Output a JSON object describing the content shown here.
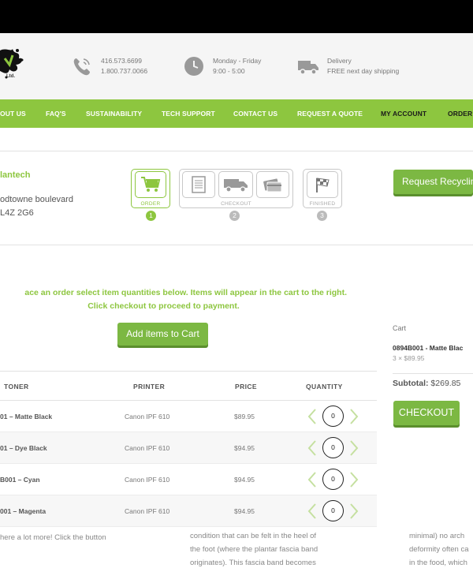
{
  "header": {
    "phone_1": "416.573.6699",
    "phone_2": "1.800.737.0066",
    "hours_1": "Monday - Friday",
    "hours_2": "9:00 - 5:00",
    "delivery_1": "Delivery",
    "delivery_2": "FREE next day shipping",
    "logo_text": "Ltd."
  },
  "nav": {
    "items": [
      "OUT US",
      "FAQ'S",
      "SUSTAINABILITY",
      "TECH SUPPORT",
      "CONTACT US",
      "REQUEST A QUOTE",
      "MY ACCOUNT",
      "ORDER"
    ]
  },
  "customer": {
    "company": "lantech",
    "street": "odtowne boulevard",
    "postal": "L4Z 2G6"
  },
  "progress": {
    "steps": [
      {
        "label": "ORDER",
        "number": "1"
      },
      {
        "label": "CHECKOUT",
        "number": "2"
      },
      {
        "label": "FINISHED",
        "number": "3"
      }
    ]
  },
  "actions": {
    "request_recycling": "Request Recyclin",
    "add_items": "Add items to Cart",
    "checkout": "CHECKOUT"
  },
  "instructions": {
    "line1": "ace an order select item quantities below. Items will appear in the cart to the right.",
    "line2": "Click checkout to proceed to payment."
  },
  "table": {
    "headers": [
      "TONER",
      "PRINTER",
      "PRICE",
      "QUANTITY"
    ],
    "rows": [
      {
        "toner": "01 – Matte Black",
        "printer": "Canon IPF 610",
        "price": "$89.95",
        "qty": "0"
      },
      {
        "toner": "01 – Dye Black",
        "printer": "Canon IPF 610",
        "price": "$94.95",
        "qty": "0"
      },
      {
        "toner": "B001 – Cyan",
        "printer": "Canon IPF 610",
        "price": "$94.95",
        "qty": "0"
      },
      {
        "toner": "001 – Magenta",
        "printer": "Canon IPF 610",
        "price": "$94.95",
        "qty": "0"
      }
    ]
  },
  "cart": {
    "label": "Cart",
    "item_name": "0894B001 - Matte Blac",
    "item_detail": "3 × $89.95",
    "subtotal_label": "Subtotal:",
    "subtotal_value": "$269.85"
  },
  "background_text": {
    "left": "here a lot more! Click the button",
    "middle_1": "condition that can be felt in the heel of",
    "middle_2": "the foot (where the plantar fascia band",
    "middle_3": "originates). This fascia band becomes",
    "right_1": "minimal) no arch",
    "right_2": "deformity often ca",
    "right_3": "in the food, which"
  },
  "colors": {
    "accent": "#8dc63f",
    "button": "#7cb843",
    "topbar": "#000000",
    "header_bg": "#f5f5f5"
  }
}
